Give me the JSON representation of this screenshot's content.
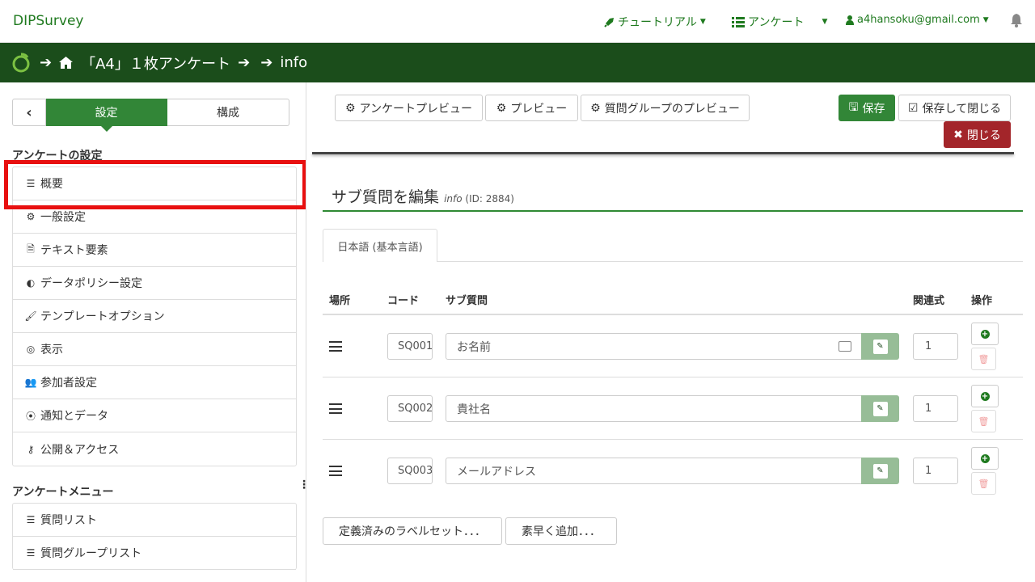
{
  "app": {
    "brand": "DIPSurvey"
  },
  "topnav": {
    "tutorial": "チュートリアル",
    "survey": "アンケート",
    "user": "a4hansoku@gmail.com"
  },
  "breadcrumb": {
    "survey_name": "「A4」１枚アンケート",
    "group": "info"
  },
  "sidebar": {
    "tab_settings": "設定",
    "tab_structure": "構成",
    "heading_settings": "アンケートの設定",
    "settings_items": [
      {
        "label": "概要",
        "icon": "list-icon"
      },
      {
        "label": "一般設定",
        "icon": "gears-icon"
      },
      {
        "label": "テキスト要素",
        "icon": "file-text-icon"
      },
      {
        "label": "データポリシー設定",
        "icon": "shield-icon"
      },
      {
        "label": "テンプレートオプション",
        "icon": "paint-brush-icon"
      },
      {
        "label": "表示",
        "icon": "eye-slash-icon"
      },
      {
        "label": "参加者設定",
        "icon": "users-icon"
      },
      {
        "label": "通知とデータ",
        "icon": "feed-icon"
      },
      {
        "label": "公開＆アクセス",
        "icon": "key-icon"
      }
    ],
    "heading_menu": "アンケートメニュー",
    "menu_items": [
      {
        "label": "質問リスト",
        "icon": "list-icon"
      },
      {
        "label": "質問グループリスト",
        "icon": "list-icon"
      }
    ]
  },
  "toolbar": {
    "survey_preview": "アンケートプレビュー",
    "preview": "プレビュー",
    "group_preview": "質問グループのプレビュー",
    "save": "保存",
    "save_close": "保存して閉じる",
    "close": "閉じる"
  },
  "page": {
    "title": "サブ質問を編集",
    "subtitle_name": "info",
    "subtitle_id": "(ID: 2884)",
    "lang_tab": "日本語 (基本言語)"
  },
  "table": {
    "headers": {
      "position": "場所",
      "code": "コード",
      "subquestion": "サブ質問",
      "relevance": "関連式",
      "actions": "操作"
    },
    "rows": [
      {
        "code": "SQ001",
        "subquestion": "お名前",
        "relevance": "1"
      },
      {
        "code": "SQ002",
        "subquestion": "貴社名",
        "relevance": "1"
      },
      {
        "code": "SQ003",
        "subquestion": "メールアドレス",
        "relevance": "1"
      }
    ]
  },
  "bottom": {
    "labelset": "定義済みのラベルセット．．．",
    "quick_add": "素早く追加．．．"
  },
  "colors": {
    "brand_green": "#328637",
    "dark_green": "#1b4d1b",
    "danger": "#a3252a",
    "highlight": "#e81010"
  }
}
